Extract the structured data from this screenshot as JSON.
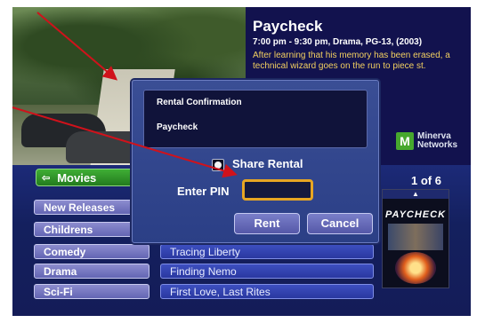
{
  "movie": {
    "title": "Paycheck",
    "meta": "7:00 pm - 9:30 pm, Drama, PG-13, (2003)",
    "description": "After learning that his memory has been erased, a technical wizard goes on the run to piece",
    "description_tail": "st."
  },
  "brand": {
    "name_line1": "Minerva",
    "name_line2": "Networks",
    "mark": "M"
  },
  "categories": {
    "header": "Movies",
    "items": [
      "New Releases",
      "Childrens",
      "Comedy",
      "Drama",
      "Sci-Fi"
    ]
  },
  "films": [
    "Tracing Liberty",
    "Finding Nemo",
    "First Love, Last Rites"
  ],
  "pagination": "1 of 6",
  "poster": {
    "title": "PAYCHECK"
  },
  "dialog": {
    "title": "Rental Confirmation",
    "movie": "Paycheck",
    "share_label": "Share Rental",
    "share_checked": true,
    "pin_label": "Enter PIN",
    "pin_value": "",
    "rent_label": "Rent",
    "cancel_label": "Cancel"
  },
  "colors": {
    "annotation_arrow": "#d0121b",
    "pin_focus": "#e7a623",
    "category_header": "#2f9a2a",
    "info_text": "#f3d060"
  }
}
